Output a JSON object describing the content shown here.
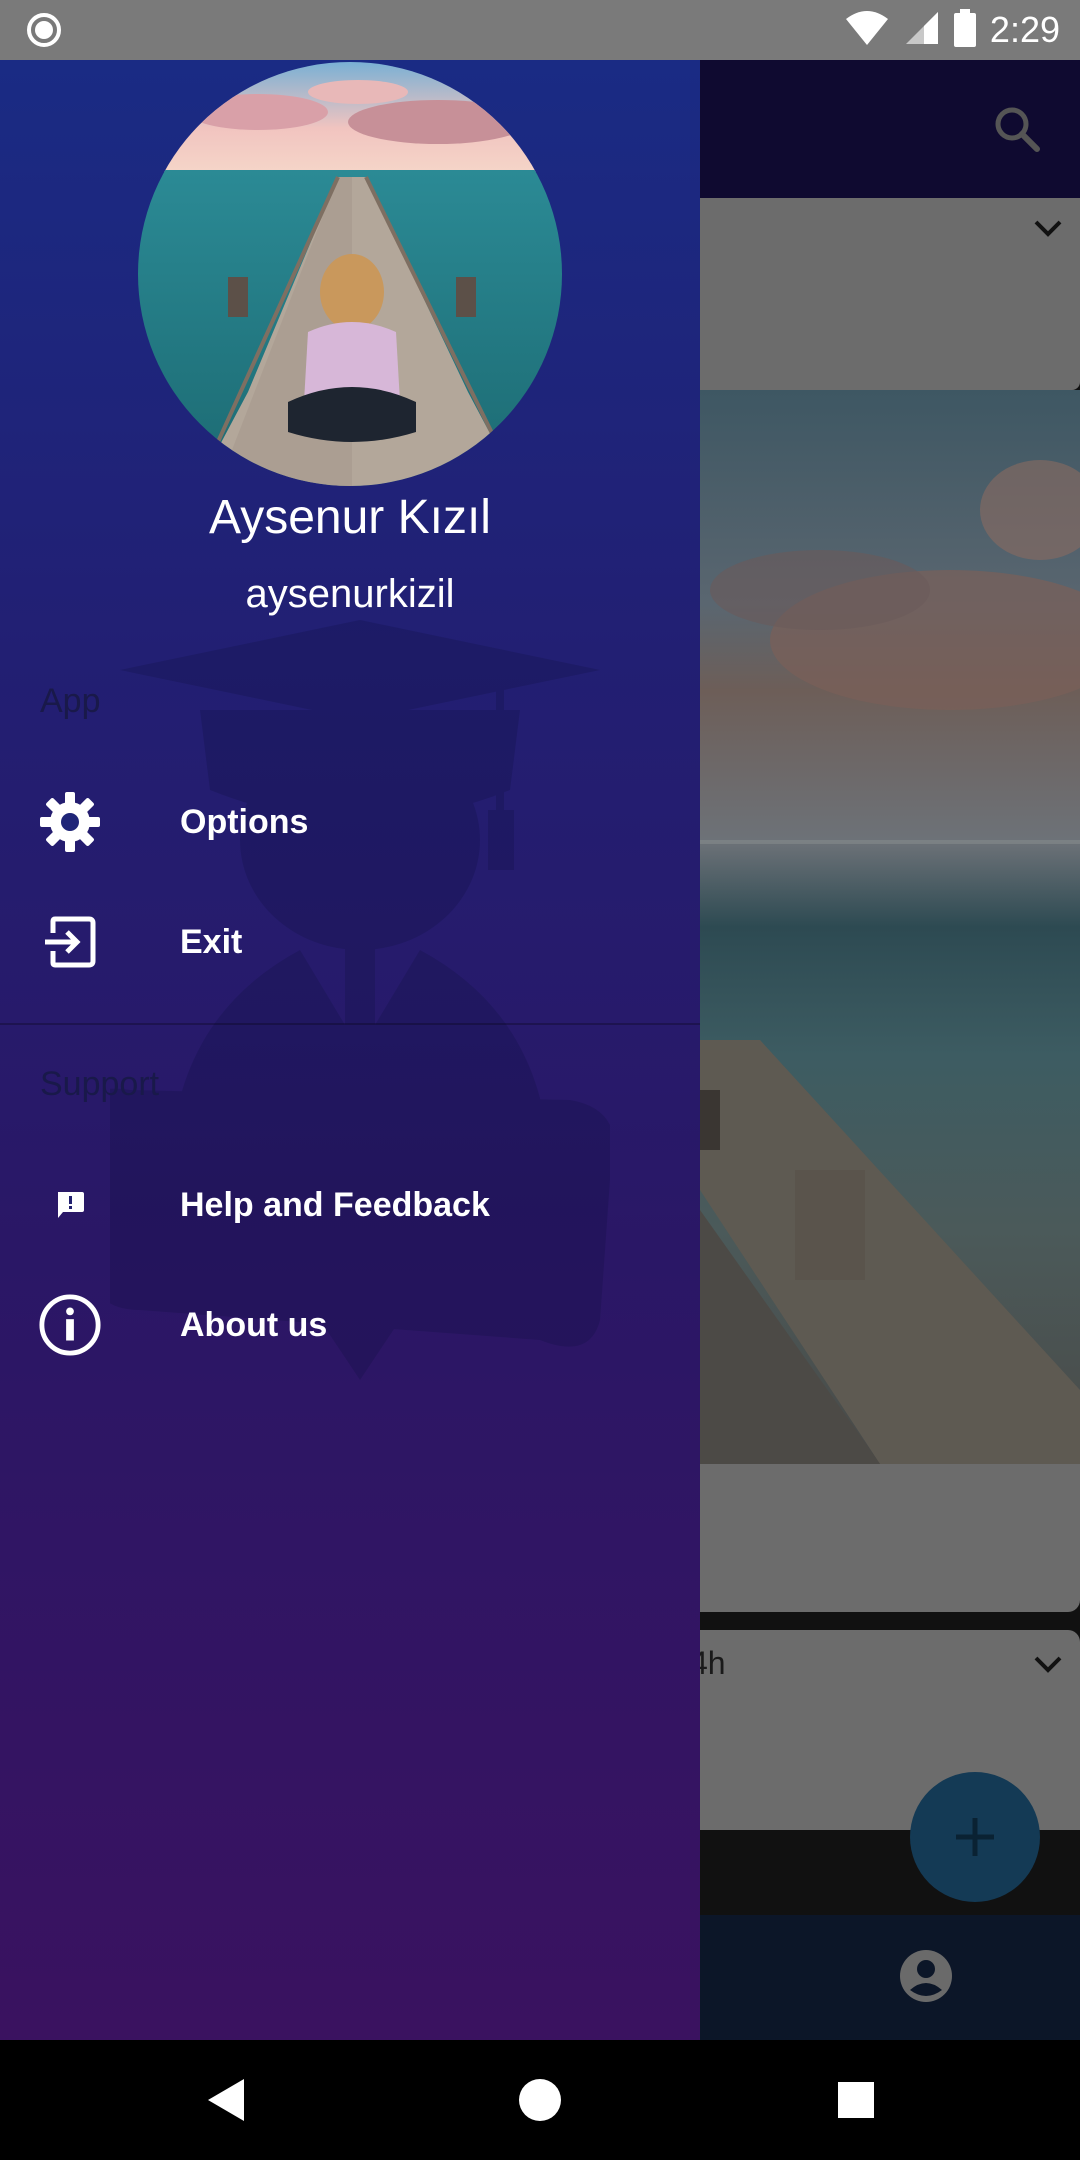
{
  "status_bar": {
    "time": "2:29",
    "icons": [
      "record-icon",
      "wifi-icon",
      "cell-signal-icon",
      "battery-icon"
    ]
  },
  "background_app": {
    "card2_text": "4h",
    "icons": [
      "search-icon",
      "chevron-down-icon",
      "add-icon",
      "account-icon"
    ]
  },
  "drawer": {
    "profile": {
      "name": "Aysenur Kızıl",
      "username": "aysenurkizil"
    },
    "sections": [
      {
        "header": "App",
        "items": [
          {
            "label": "Options",
            "icon": "gear-icon"
          },
          {
            "label": "Exit",
            "icon": "exit-icon"
          }
        ]
      },
      {
        "header": "Support",
        "items": [
          {
            "label": "Help and Feedback",
            "icon": "feedback-icon"
          },
          {
            "label": "About us",
            "icon": "info-icon"
          }
        ]
      }
    ]
  },
  "nav_bar": {
    "buttons": [
      "back-icon",
      "home-icon",
      "recents-icon"
    ]
  },
  "colors": {
    "drawer_top": "#1a2b84",
    "drawer_bottom": "#3a1260",
    "section_header": "#19194a",
    "text": "#ffffff"
  }
}
